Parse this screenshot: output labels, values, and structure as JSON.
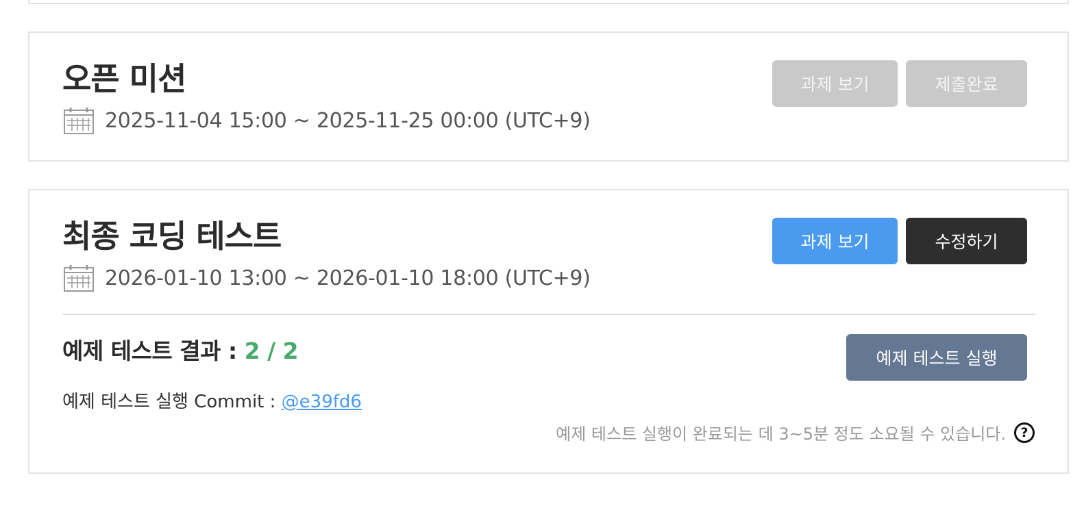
{
  "missions": [
    {
      "title": "오픈 미션",
      "date_range": "2025-11-04 15:00 ~ 2025-11-25 00:00 (UTC+9)",
      "view_button": "과제 보기",
      "submit_button": "제출완료"
    },
    {
      "title": "최종 코딩 테스트",
      "date_range": "2026-01-10 13:00 ~ 2026-01-10 18:00 (UTC+9)",
      "view_button": "과제 보기",
      "edit_button": "수정하기",
      "result_label": "예제 테스트 결과 : ",
      "result_score": "2 / 2",
      "run_button": "예제 테스트 실행",
      "commit_label": "예제 테스트 실행 Commit : ",
      "commit_hash": "@e39fd6",
      "notice": "예제 테스트 실행이 완료되는 데 3~5분 정도 소요될 수 있습니다.",
      "help_glyph": "?"
    }
  ],
  "colors": {
    "primary": "#4a9bf0",
    "dark": "#2e2e2e",
    "slate": "#647894",
    "disabled": "#c9c9c9",
    "score": "#4aa96c"
  },
  "icons": {
    "calendar": "calendar-icon",
    "help": "question-circle-icon"
  }
}
